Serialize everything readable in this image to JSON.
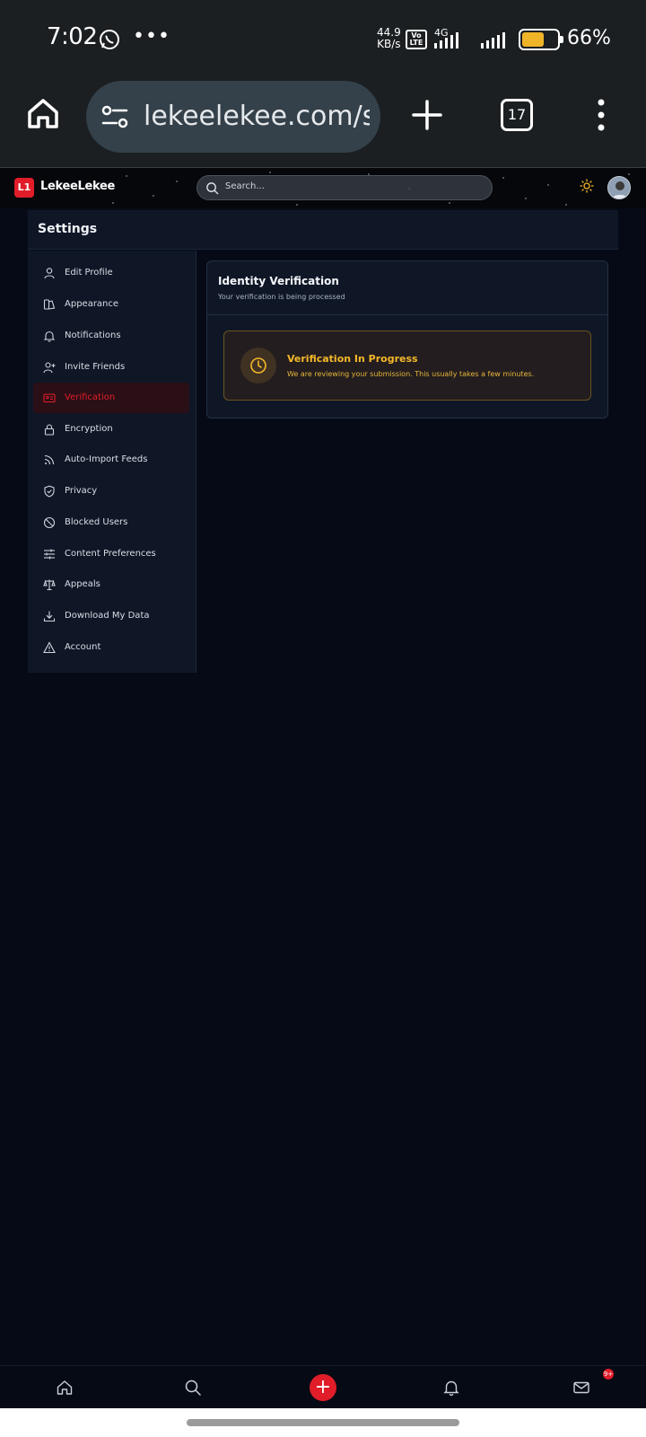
{
  "status_bar": {
    "time": "7:02",
    "net_speed_value": "44.9",
    "net_speed_unit": "KB/s",
    "volte_top": "Vo",
    "volte_bottom": "LTE",
    "network_type": "4G",
    "battery_percent": "66%",
    "battery_level": 0.66,
    "battery_color": "#f0b429"
  },
  "browser": {
    "url": "lekeelekee.com/s",
    "tab_count": "17"
  },
  "header": {
    "logo_mark": "L1",
    "logo_text": "LekeeLekee",
    "search_placeholder": "Search..."
  },
  "settings": {
    "title": "Settings",
    "nav_items": [
      {
        "label": "Edit Profile",
        "icon": "user-icon"
      },
      {
        "label": "Appearance",
        "icon": "palette-icon"
      },
      {
        "label": "Notifications",
        "icon": "bell-icon"
      },
      {
        "label": "Invite Friends",
        "icon": "user-plus-icon"
      },
      {
        "label": "Verification",
        "icon": "id-card-icon",
        "active": true
      },
      {
        "label": "Encryption",
        "icon": "lock-icon"
      },
      {
        "label": "Auto-Import Feeds",
        "icon": "rss-icon"
      },
      {
        "label": "Privacy",
        "icon": "shield-icon"
      },
      {
        "label": "Blocked Users",
        "icon": "ban-icon"
      },
      {
        "label": "Content Preferences",
        "icon": "sliders-icon"
      },
      {
        "label": "Appeals",
        "icon": "scale-icon"
      },
      {
        "label": "Download My Data",
        "icon": "download-icon"
      },
      {
        "label": "Account",
        "icon": "warning-icon"
      }
    ]
  },
  "verification": {
    "title": "Identity Verification",
    "subtitle": "Your verification is being processed",
    "status_title": "Verification In Progress",
    "status_text": "We are reviewing your submission. This usually takes a few minutes."
  },
  "bottom_nav": {
    "notification_badge": "9+"
  },
  "colors": {
    "accent": "#e11d2a",
    "warning": "#f5b82a",
    "background": "#050a16",
    "panel": "#0f1726"
  }
}
